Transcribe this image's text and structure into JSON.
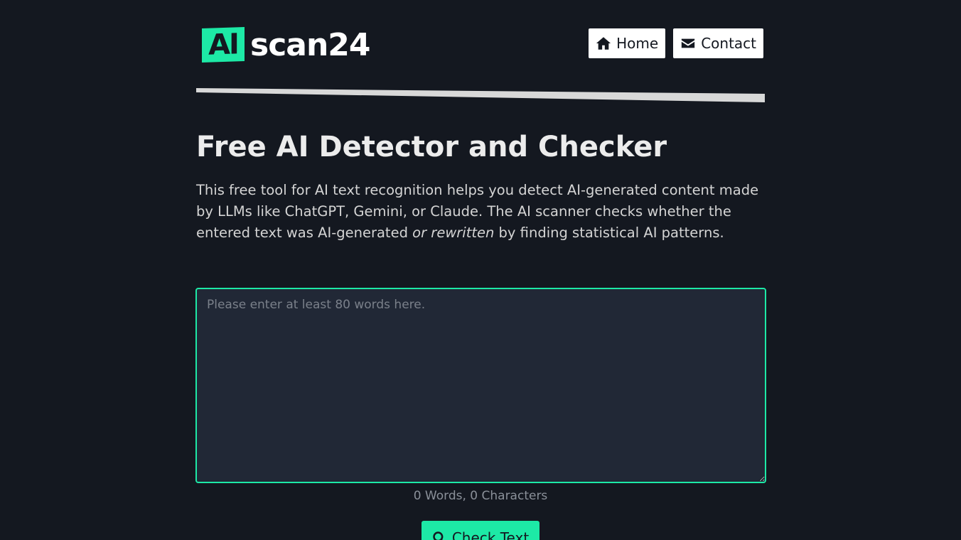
{
  "header": {
    "logo_badge": "AI",
    "logo_text": "scan24",
    "nav": {
      "home_label": "Home",
      "home_icon": "home-icon",
      "contact_label": "Contact",
      "contact_icon": "envelope-icon"
    }
  },
  "main": {
    "title": "Free AI Detector and Checker",
    "intro_part1": "This free tool for AI text recognition helps you detect AI-generated content made by LLMs like ChatGPT, Gemini, or Claude. The AI scanner checks whether the entered text was AI-generated ",
    "intro_emphasis": "or rewritten",
    "intro_part2": " by finding statistical AI patterns.",
    "input": {
      "value": "",
      "placeholder": "Please enter at least 80 words here."
    },
    "counter": "0 Words, 0 Characters",
    "check_button": {
      "label": "Check Text",
      "icon": "search-icon"
    }
  },
  "colors": {
    "background": "#141820",
    "accent": "#1de9a6",
    "input_bg": "#212836"
  }
}
